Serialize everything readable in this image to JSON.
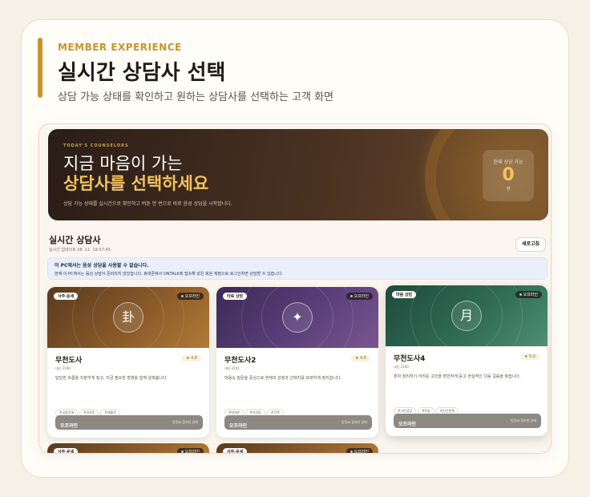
{
  "page": {
    "kicker": "MEMBER EXPERIENCE",
    "headline": "실시간 상담사 선택",
    "subline": "상담 가능 상태를 확인하고 원하는 상담사를 선택하는 고객 화면"
  },
  "hero": {
    "eyebrow": "TODAY'S COUNSELORS",
    "line1": "지금 마음이 가는",
    "line2": "상담사를 선택하세요",
    "description": "상담 가능 상태를 실시간으로 확인하고 버튼 한 번으로 바로 음성 상담을 시작합니다.",
    "available_label": "현재 상담 가능",
    "available_count": "0",
    "available_unit": "명"
  },
  "section": {
    "title": "실시간 상담사",
    "updated": "실시간 업데이트 08. 11. 19:57:45",
    "refresh_label": "새로고침"
  },
  "notice": {
    "line1": "이 PC에서는 음성 상담을 사용할 수 없습니다.",
    "line2": "현재 이 PC에서는 음성 상담이 준비되지 않았습니다. 휴대폰에서 ONTALK에 접속해 같은 회원 계정으로 로그인하면 상담할 수 있습니다."
  },
  "colors": {
    "accent": "#c8952c",
    "hero_number": "#f4c35c",
    "card_button": "#8d8882"
  },
  "cards": [
    {
      "tag": "사주·운세",
      "status": "오프라인",
      "symbol": "卦",
      "name": "무천도사",
      "since": "내신 2100",
      "rating": "★ 4.8",
      "description": "답답한 흐름을 차분하게 짚고, 지금 필요한 방향을 함께 살펴봅니다.",
      "chips": [
        "#궁합운세",
        "#진로운",
        "#재물운"
      ],
      "button": "오프라인",
      "button_note": "방장씨 접속한 상태",
      "banner": "linear-gradient(135deg, #5a3a1e 0%, #8a5a2a 55%, #b07a36 100%)"
    },
    {
      "tag": "타로 상담",
      "status": "오프라인",
      "symbol": "✦",
      "name": "무천도사2",
      "since": "내신 2101",
      "rating": "★ 4.8",
      "description": "마음속 질문을 중심으로 현재의 감정과 선택지를 또렷하게 정리합니다.",
      "chips": [
        "#연애운",
        "#속마음",
        "#선택"
      ],
      "button": "오프라인",
      "button_note": "방장씨 접속한 상태",
      "banner": "linear-gradient(135deg, #3b2a55 0%, #5a3f7a 55%, #7a5690 100%)"
    },
    {
      "tag": "마음 상담",
      "status": "오프라인",
      "symbol": "月",
      "name": "무천도사4",
      "since": "내신 2100",
      "rating": "★ 5.0",
      "description": "혼자 정리하기 어려운 고민을 편안하게 듣고 현실적인 다음 걸음을 찾습니다.",
      "chips": [
        "#고민상담",
        "#직장",
        "#인간관계"
      ],
      "button": "오프라인",
      "button_note": "방장씨 접속한 상태",
      "banner": "linear-gradient(135deg, #1f4a3c 0%, #2f6b55 55%, #4f8f74 100%)"
    }
  ],
  "more_cards": [
    {
      "tag": "사주·운세",
      "status": "오프라인",
      "banner": "linear-gradient(135deg, #5a3a1e 0%, #8a5a2a 55%, #b07a36 100%)"
    },
    {
      "tag": "사주·운세",
      "status": "오프라인",
      "banner": "linear-gradient(135deg, #5a3a1e 0%, #8a5a2a 55%, #b07a36 100%)"
    }
  ]
}
